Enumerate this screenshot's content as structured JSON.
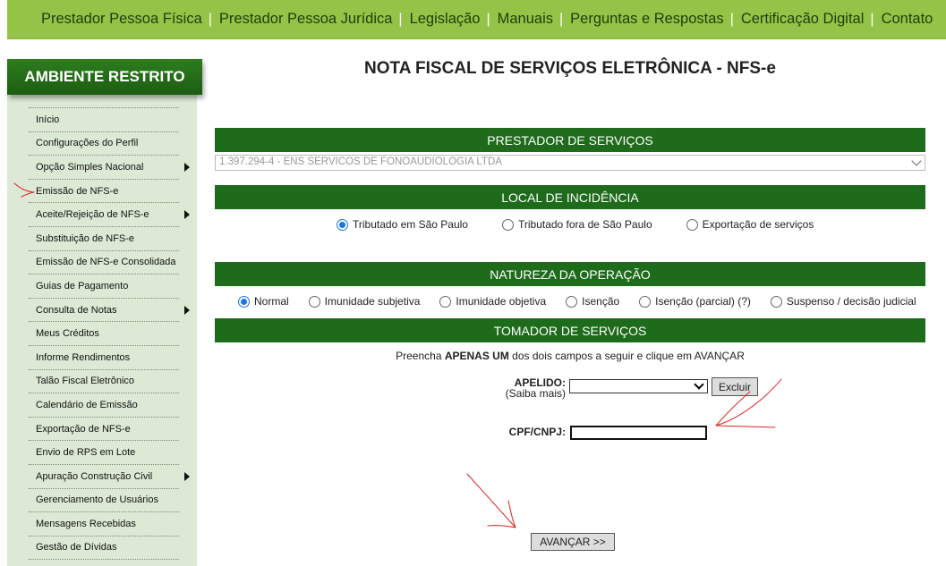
{
  "topnav": {
    "items": [
      "Prestador Pessoa Física",
      "Prestador Pessoa Jurídica",
      "Legislação",
      "Manuais",
      "Perguntas e Respostas",
      "Certificação Digital",
      "Contato"
    ],
    "separator": "|"
  },
  "sidebar": {
    "title": "AMBIENTE RESTRITO",
    "items": [
      {
        "label": "Início"
      },
      {
        "label": "Configurações do Perfil"
      },
      {
        "label": "Opção Simples Nacional",
        "submenu": true
      },
      {
        "label": "Emissão de NFS-e"
      },
      {
        "label": "Aceite/Rejeição de NFS-e",
        "submenu": true
      },
      {
        "label": "Substituição de NFS-e"
      },
      {
        "label": "Emissão de NFS-e Consolidada"
      },
      {
        "label": "Guias de Pagamento"
      },
      {
        "label": "Consulta de Notas",
        "submenu": true
      },
      {
        "label": "Meus Créditos"
      },
      {
        "label": "Informe Rendimentos"
      },
      {
        "label": "Talão Fiscal Eletrônico"
      },
      {
        "label": "Calendário de Emissão"
      },
      {
        "label": "Exportação de NFS-e"
      },
      {
        "label": "Envio de RPS em Lote"
      },
      {
        "label": "Apuração Construção Civil",
        "submenu": true
      },
      {
        "label": "Gerenciamento de Usuários"
      },
      {
        "label": "Mensagens Recebidas"
      },
      {
        "label": "Gestão de Dívidas"
      }
    ]
  },
  "main": {
    "title": "NOTA FISCAL DE SERVIÇOS ELETRÔNICA - NFS-e",
    "prestador": {
      "heading": "PRESTADOR DE SERVIÇOS",
      "selected": "1.397.294-4 - ENS SERVICOS DE FONOAUDIOLOGIA LTDA"
    },
    "local": {
      "heading": "LOCAL DE INCIDÊNCIA",
      "options": [
        "Tributado em São Paulo",
        "Tributado fora de São Paulo",
        "Exportação de serviços"
      ],
      "selected_index": 0
    },
    "natureza": {
      "heading": "NATUREZA DA OPERAÇÃO",
      "options": [
        "Normal",
        "Imunidade subjetiva",
        "Imunidade objetiva",
        "Isenção",
        "Isenção (parcial) (?)",
        "Suspenso / decisão judicial"
      ],
      "selected_index": 0
    },
    "tomador": {
      "heading": "TOMADOR DE SERVIÇOS",
      "instruction_prefix": "Preencha ",
      "instruction_bold": "APENAS UM",
      "instruction_suffix": " dos dois campos a seguir e clique em AVANÇAR",
      "apelido_label": "APELIDO:",
      "apelido_help": "(Saiba mais)",
      "apelido_value": "",
      "excluir_label": "Excluir",
      "cpf_label": "CPF/CNPJ:",
      "cpf_value": "",
      "avancar_label": "AVANÇAR >>"
    }
  },
  "colors": {
    "topnav_bg": "#94c447",
    "header_green": "#1f6b1c",
    "sidebar_bg": "#dce9d5",
    "annotation_red": "#e02020"
  }
}
